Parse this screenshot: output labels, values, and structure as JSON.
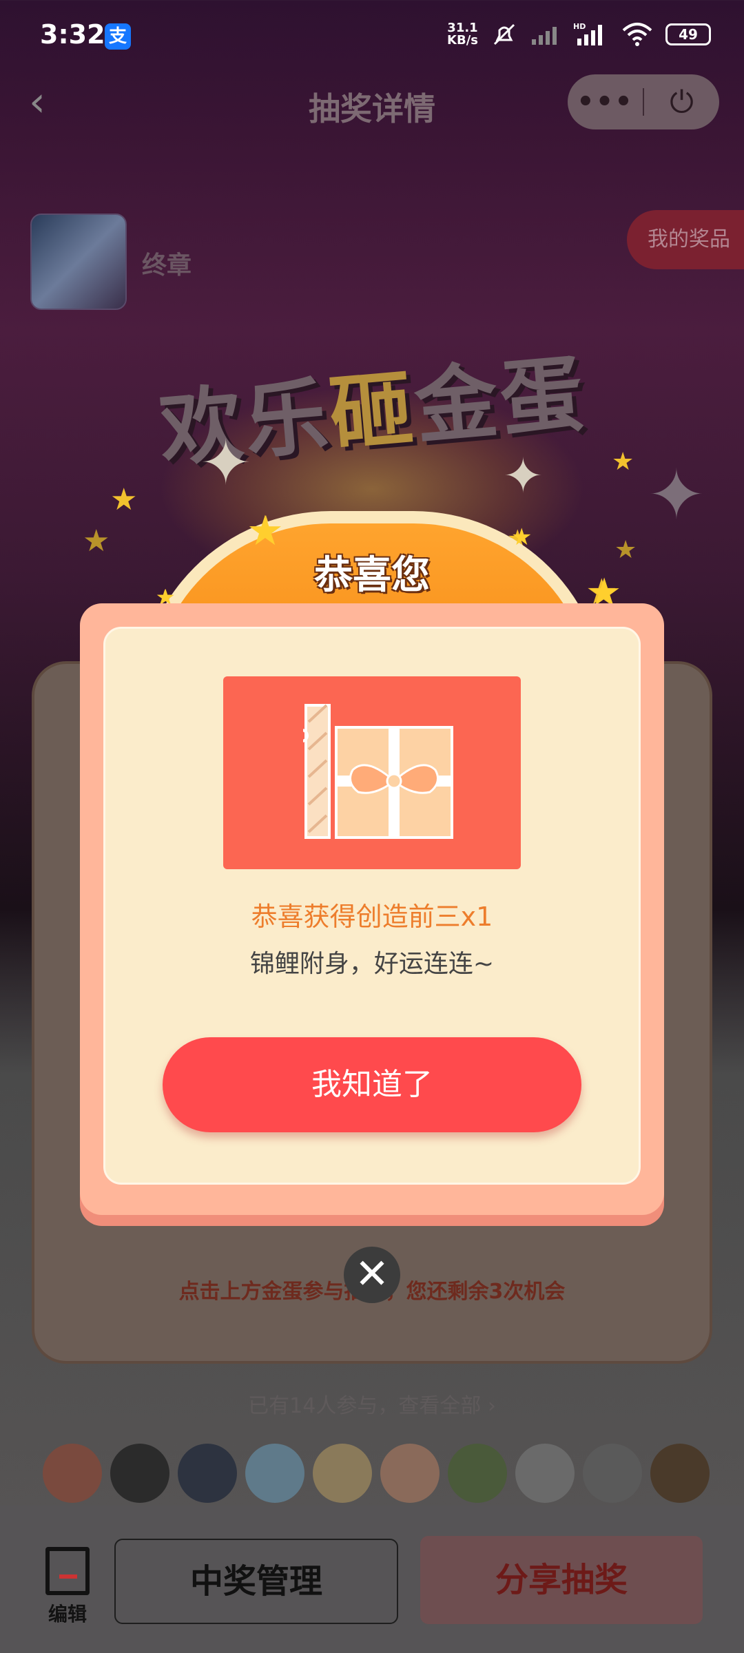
{
  "status_bar": {
    "time": "3:32",
    "app_badge": "支",
    "net_speed_value": "31.1",
    "net_speed_unit": "KB/s",
    "battery": "49"
  },
  "nav": {
    "back_icon": "‹",
    "title": "抽奖详情",
    "more_icon": "•••",
    "power_icon": "⏻"
  },
  "host": {
    "name": "终章"
  },
  "my_prizes_label": "我的奖品",
  "banner": {
    "title_part1": "欢乐",
    "title_part2": "砸",
    "title_part3": "金蛋"
  },
  "game": {
    "hint": "点击上方金蛋参与抽奖，您还剩余3次机会",
    "participants": "已有14人参与，查看全部 ›"
  },
  "participant_avatar_colors": [
    "#7a4a3e",
    "#2b2b2b",
    "#2d3340",
    "#5f7a8a",
    "#8a7a5a",
    "#8a6a5a",
    "#4a5a3a",
    "#6a6a6a",
    "#5a5a5a",
    "#4a3a2a"
  ],
  "bottom_bar": {
    "edit_label": "编辑",
    "manage_label": "中奖管理",
    "share_label": "分享抽奖"
  },
  "modal": {
    "heading": "恭喜您",
    "prize_title": "恭喜获得创造前三x1",
    "prize_subtitle": "锦鲤附身，好运连连~",
    "confirm_label": "我知道了",
    "close_icon": "✕"
  },
  "colors": {
    "accent_red": "#ff4a4d",
    "prize_card": "#fc6652",
    "dome_orange": "#f58a15",
    "modal_frame": "#ffb69a",
    "modal_body": "#fbeccb"
  }
}
